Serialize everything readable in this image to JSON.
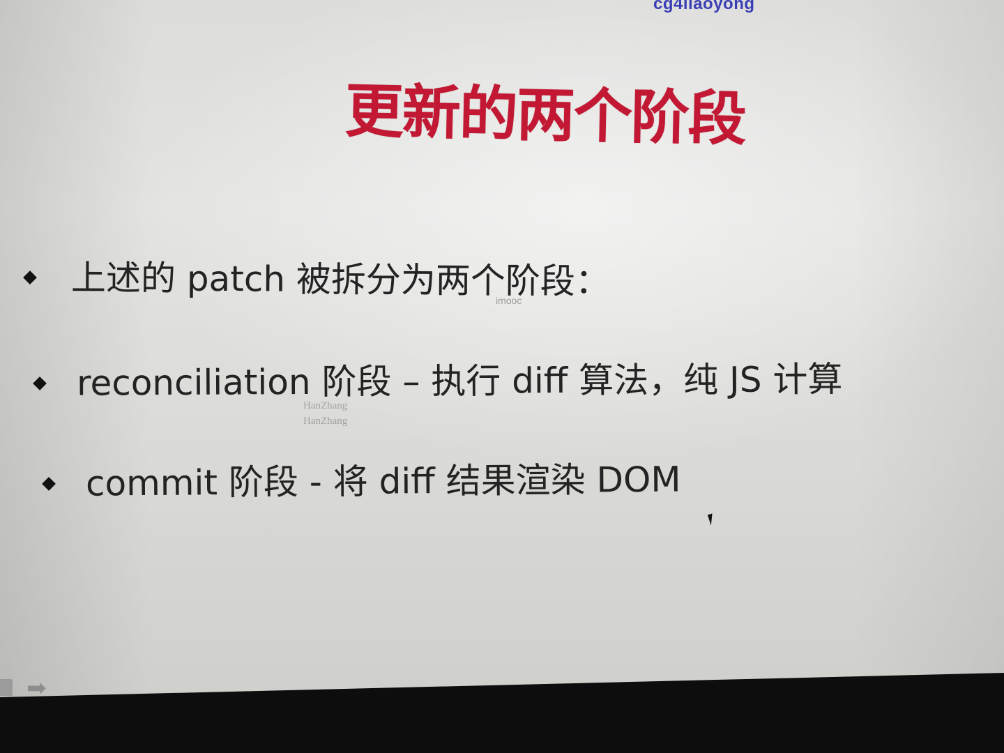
{
  "watermarks": {
    "top_user": "cg4liaoyong",
    "center": "imooc",
    "author_1": "HanZhang",
    "author_2": "HanZhang"
  },
  "slide": {
    "title": "更新的两个阶段",
    "bullets": [
      "上述的 patch 被拆分为两个阶段：",
      "reconciliation 阶段 – 执行 diff 算法，纯 JS 计算",
      "commit 阶段 - 将 diff 结果渲染 DOM"
    ]
  },
  "navigation": {
    "prev_icon": "slide-prev-icon",
    "next_glyph": "➡"
  },
  "colors": {
    "title": "#c21834",
    "watermark_top": "#3a3fb5",
    "text": "#232323"
  }
}
